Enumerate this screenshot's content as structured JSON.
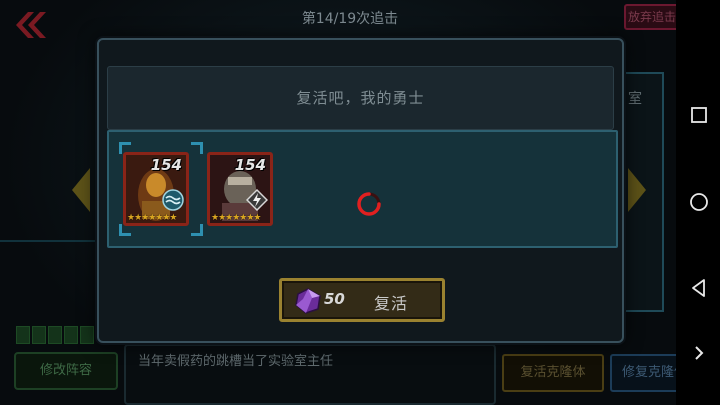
{
  "top_bar": {
    "title": "第14/19次追击",
    "abandon_label": "放弃追击"
  },
  "background": {
    "card_text": "室",
    "modify_label": "修改阵容",
    "story_text": "当年卖假药的跳槽当了实验室主任",
    "revive_team_label": "复活克隆体",
    "repair_team_label": "修复克隆体"
  },
  "dialog": {
    "title": "复活吧，我的勇士",
    "heroes": [
      {
        "level": "154",
        "stars": "★★★★★★★",
        "element": "water-icon",
        "frame_color": "#8a2418"
      },
      {
        "level": "154",
        "stars": "★★★★★★★",
        "element": "lightning-icon",
        "frame_color": "#8a2418"
      }
    ],
    "cost": "50",
    "revive_label": "复活",
    "spinner_color": "#e02020"
  },
  "colors": {
    "accent_gold": "#9a8230",
    "panel_teal": "#15323a",
    "danger_red": "#6b1830"
  },
  "navbar": {
    "icons": [
      "square-icon",
      "circle-icon",
      "back-triangle-icon",
      "chevron-right-icon"
    ]
  }
}
